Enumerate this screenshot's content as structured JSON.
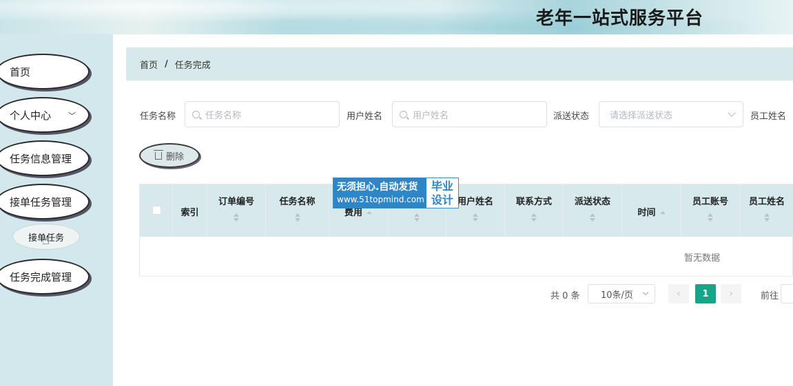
{
  "header": {
    "title": "老年一站式服务平台"
  },
  "sidebar": {
    "items": [
      {
        "label": "首页"
      },
      {
        "label": "个人中心"
      },
      {
        "label": "任务信息管理"
      },
      {
        "label": "接单任务管理"
      },
      {
        "label": "任务完成管理"
      }
    ],
    "sub_item": "接单任务"
  },
  "breadcrumb": {
    "home": "首页",
    "separator": "/",
    "current": "任务完成"
  },
  "search": {
    "task_name_label": "任务名称",
    "task_name_placeholder": "任务名称",
    "user_name_label": "用户姓名",
    "user_name_placeholder": "用户姓名",
    "dispatch_status_label": "派送状态",
    "dispatch_status_placeholder": "请选择派送状态",
    "staff_name_label": "员工姓名"
  },
  "toolbar": {
    "delete_label": "删除"
  },
  "table": {
    "columns": [
      "索引",
      "订单编号",
      "任务名称",
      "费用",
      "",
      "用户姓名",
      "联系方式",
      "派送状态",
      "时间",
      "员工账号",
      "员工姓名"
    ],
    "empty_text": "暂无数据"
  },
  "pagination": {
    "total_text": "共 0 条",
    "page_size": "10条/页",
    "prev": "‹",
    "current_page": "1",
    "next": "›",
    "goto_label": "前往"
  },
  "watermark": {
    "line1": "无须担心.自动发货",
    "line2": "www.51topmind.com",
    "side_top": "毕业",
    "side_bottom": "设计"
  },
  "colors": {
    "accent": "#17a58a",
    "sidebar_bg": "#d3e8ed",
    "table_header_bg": "#d7e9ec"
  }
}
